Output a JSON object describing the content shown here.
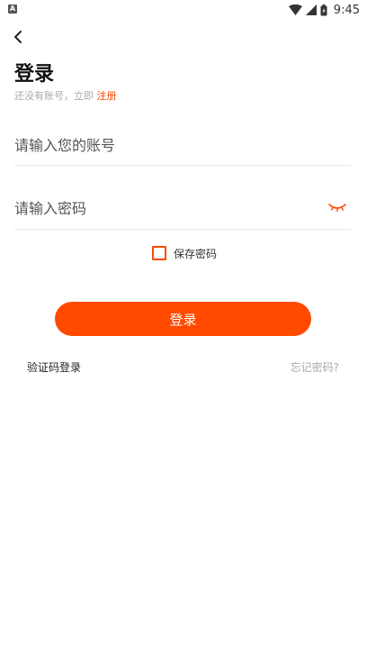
{
  "status_bar": {
    "app_icon_letter": "A",
    "time": "9:45",
    "icons": [
      "wifi-icon",
      "signal-icon",
      "battery-icon"
    ]
  },
  "header": {
    "back_icon": "chevron-left-icon",
    "title": "登录",
    "register_prompt": "还没有账号，立即",
    "register_link": "注册"
  },
  "form": {
    "account_placeholder": "请输入您的账号",
    "account_value": "",
    "password_placeholder": "请输入密码",
    "password_value": "",
    "password_toggle_icon": "eye-closed-icon",
    "save_password_label": "保存密码",
    "save_password_checked": false
  },
  "actions": {
    "login_button": "登录",
    "sms_login": "验证码登录",
    "forgot_password": "忘记密码?"
  },
  "colors": {
    "accent": "#ff4a00",
    "hint_text": "#aaaaaa",
    "divider": "#e8e8e8"
  }
}
